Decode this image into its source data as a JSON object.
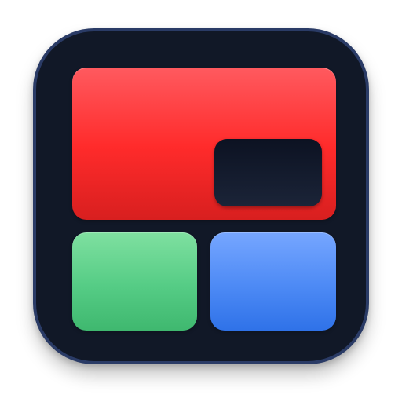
{
  "icon": {
    "name": "split-screen-layout-icon",
    "colors": {
      "tile_background": "#111827",
      "tile_border": "#2a3b66",
      "main_panel": "#ff2b2b",
      "pip_panel": "#0c1222",
      "left_bottom_panel": "#55cc85",
      "right_bottom_panel": "#4d8af5"
    }
  }
}
